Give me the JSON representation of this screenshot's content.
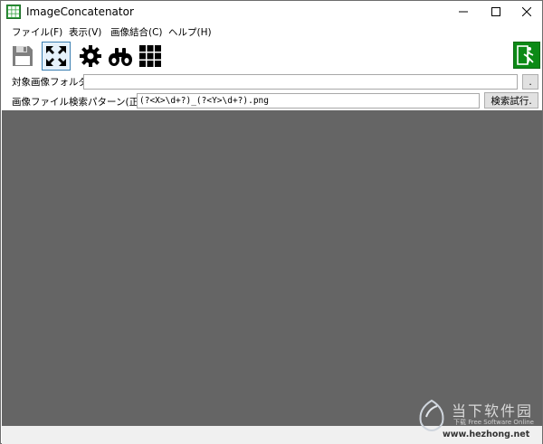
{
  "window": {
    "title": "ImageConcatenator"
  },
  "menu": {
    "items": [
      {
        "label": "ファイル(F)"
      },
      {
        "label": "表示(V)"
      },
      {
        "label": "画像結合(C)"
      },
      {
        "label": "ヘルプ(H)"
      }
    ]
  },
  "toolbar": {
    "icons": [
      "save-icon",
      "fit-screen-icon",
      "gear-icon",
      "binoculars-icon",
      "grid-icon"
    ],
    "selected": "fit-screen-icon",
    "exit_icon": "exit-icon"
  },
  "form": {
    "folder_label": "対象画像フォルダ",
    "folder_value": "",
    "browse_label": ".",
    "pattern_label": "画像ファイル検索パターン(正規表",
    "pattern_value": "(?<X>\\d+?)_(?<Y>\\d+?).png",
    "search_button": "検索試行."
  },
  "colors": {
    "canvas_bg": "#656565",
    "exit_button_bg": "#0c8a16",
    "selected_tool_border": "#3c7fb1"
  },
  "watermark": {
    "name": "当下软件园",
    "subtitle": "下载 Free Software Online",
    "url": "www.hezhong.net"
  }
}
